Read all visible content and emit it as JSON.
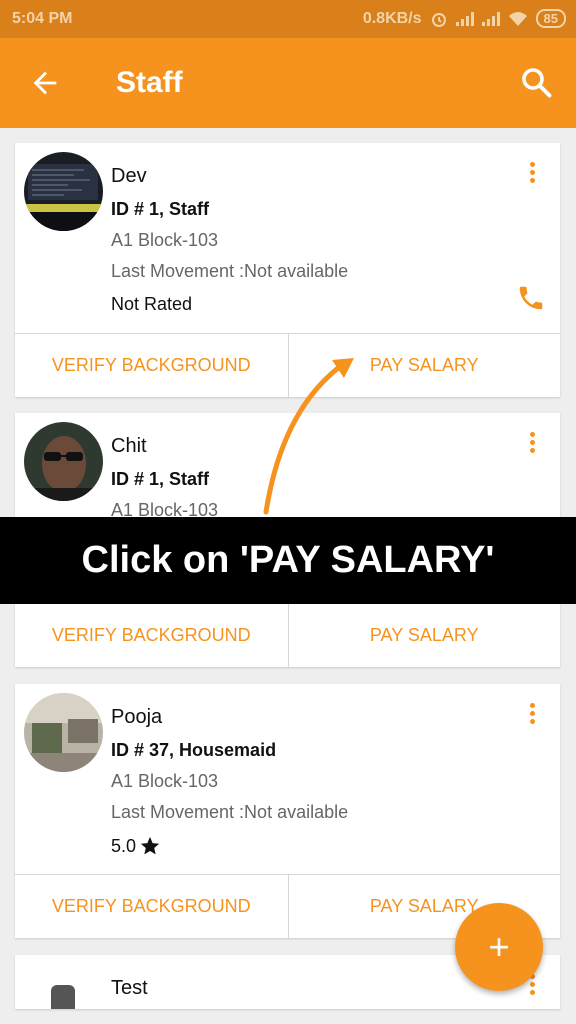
{
  "status_bar": {
    "time": "5:04 PM",
    "speed": "0.8KB/s",
    "battery": "85"
  },
  "app_bar": {
    "title": "Staff",
    "back_icon": "arrow-back-icon",
    "search_icon": "search-icon"
  },
  "staff": [
    {
      "name": "Dev",
      "id_line": "ID # 1, Staff",
      "block": "A1 Block-103",
      "movement": "Last Movement :Not available",
      "rating": "Not Rated"
    },
    {
      "name": "Chit",
      "id_line": "ID # 1, Staff",
      "block": "A1 Block-103"
    },
    {
      "name": "Pooja",
      "id_line": "ID # 37, Housemaid",
      "block": "A1 Block-103",
      "movement": "Last Movement :Not available",
      "rating": "5.0"
    },
    {
      "name": "Test"
    }
  ],
  "actions": {
    "verify": "VERIFY BACKGROUND",
    "pay": "PAY SALARY"
  },
  "overlay": {
    "text": "Click on 'PAY SALARY'"
  },
  "fab": {
    "label": "+"
  },
  "colors": {
    "accent": "#f6931e",
    "status_bar": "#d9801a",
    "background": "#eeeeee"
  }
}
